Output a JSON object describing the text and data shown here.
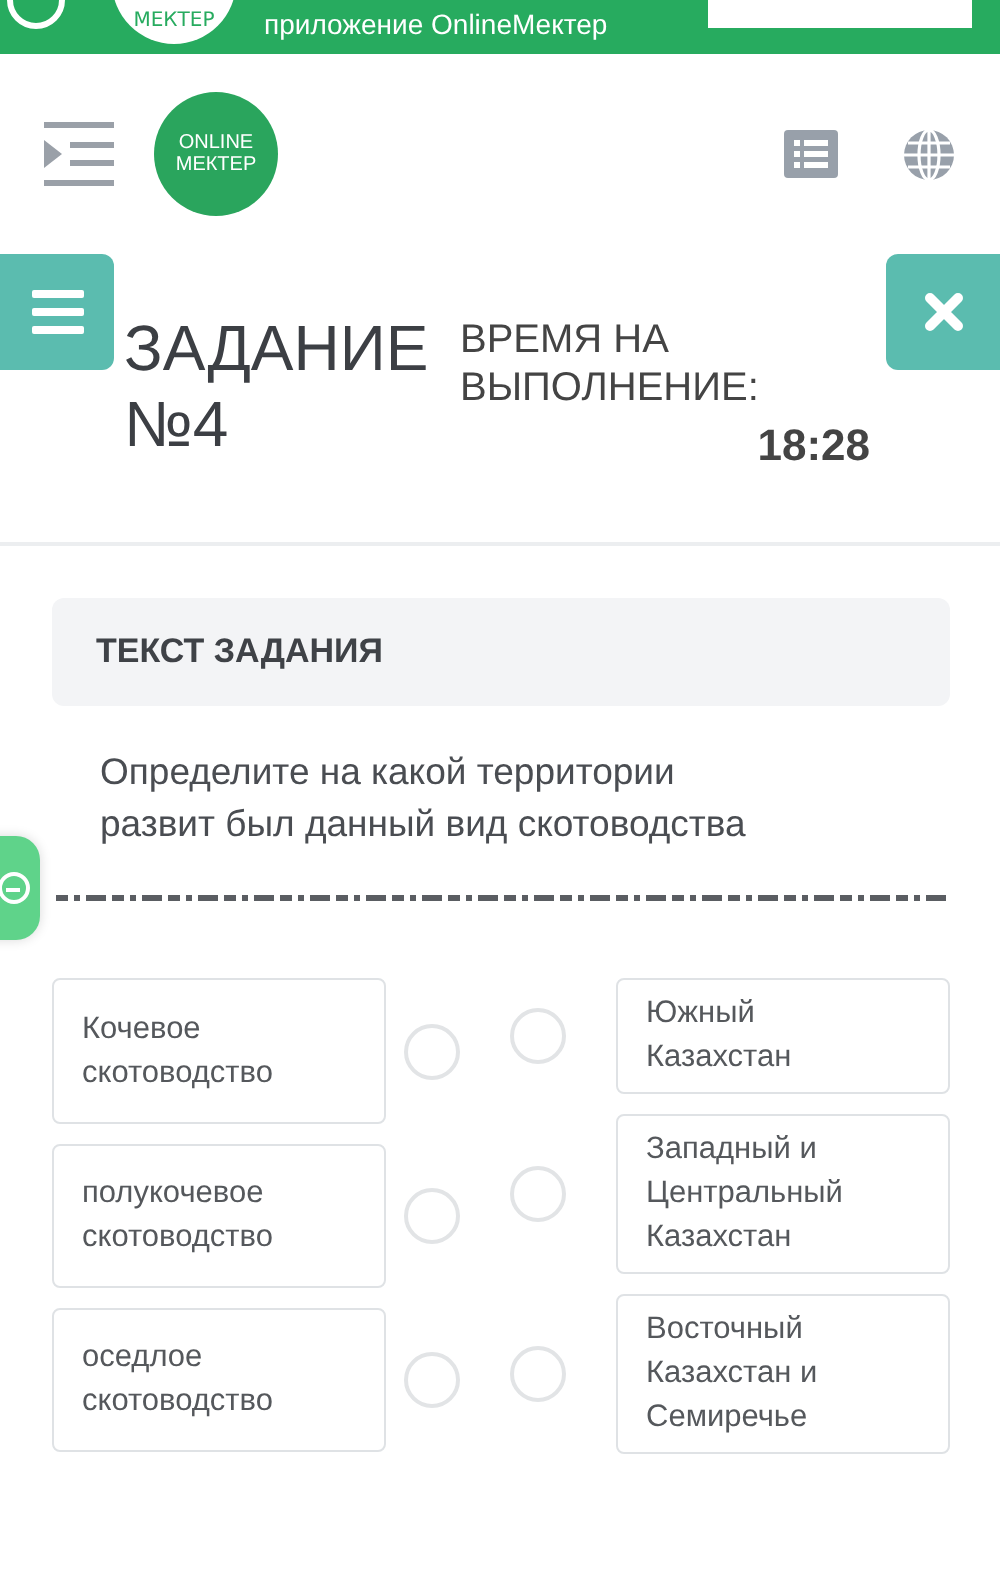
{
  "banner": {
    "logo_text": "МЕКТЕР",
    "text": "приложение OnlineМектер"
  },
  "header": {
    "logo": [
      "ONLINE",
      "МЕКТЕР"
    ]
  },
  "task": {
    "title": "ЗАДАНИЕ №4",
    "time_label": "ВРЕМЯ НА ВЫПОЛНЕНИЕ:",
    "time": "18:28"
  },
  "card": {
    "heading": "ТЕКСТ ЗАДАНИЯ",
    "question": "Определите на какой территории развит был данный вид скотоводства"
  },
  "left_options": [
    {
      "text": "Кочевое скотоводство",
      "selected": false
    },
    {
      "text": "полукочевое скотоводство",
      "selected": false
    },
    {
      "text": "оседлое скотоводство",
      "selected": false
    }
  ],
  "right_options": [
    {
      "text": "Южный Казахстан",
      "selected": false
    },
    {
      "text": "Западный и Центральный Казахстан",
      "selected": false
    },
    {
      "text": "Восточный Казахстан и Семиречье",
      "selected": false
    }
  ]
}
